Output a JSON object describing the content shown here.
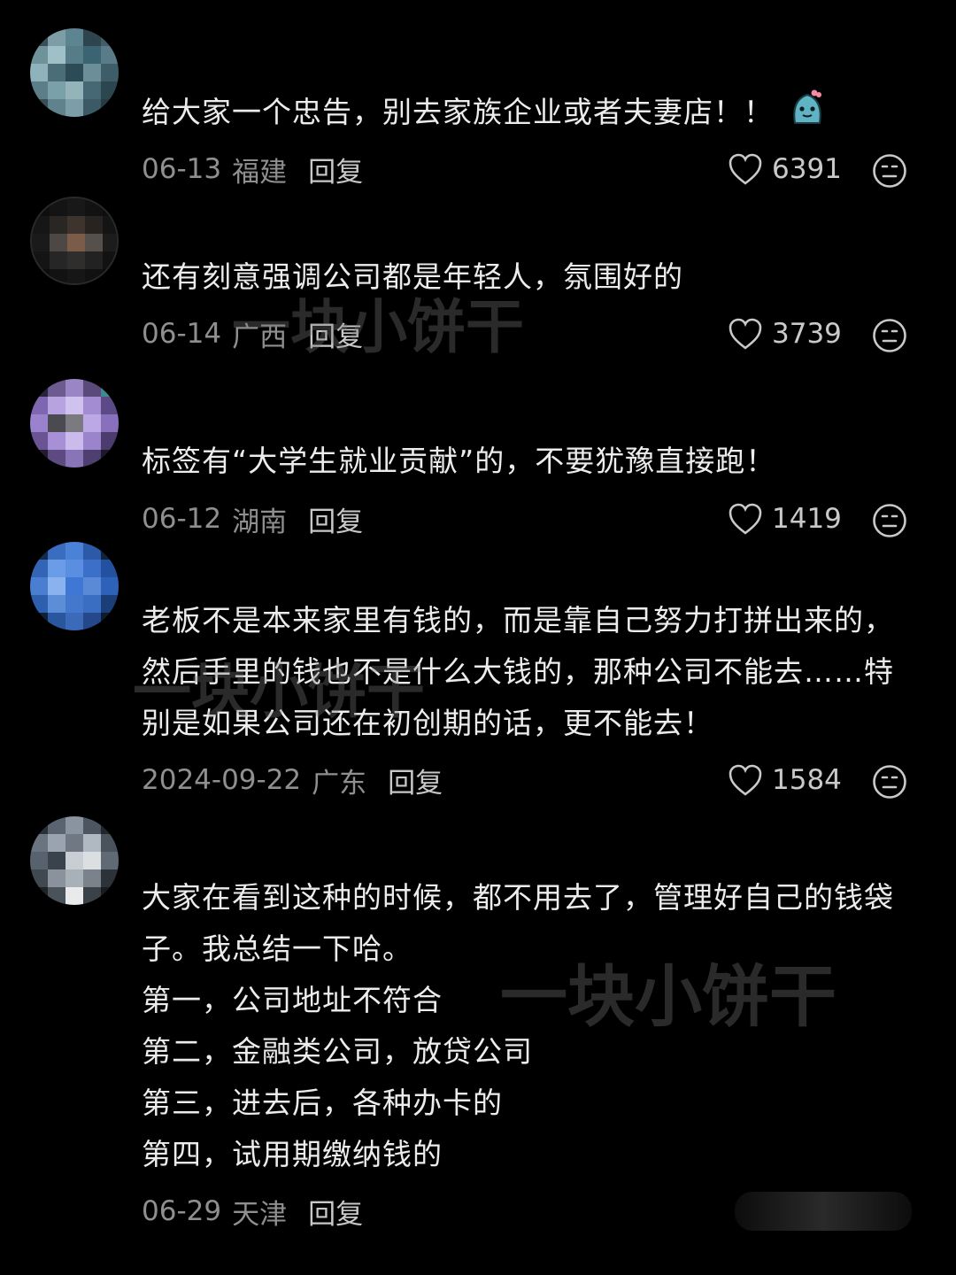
{
  "comments": [
    {
      "text": "给大家一个忠告，别去家族企业或者夫妻店！！",
      "emoji_icon": "cute-blob-emoji-icon",
      "date": "06-13",
      "location": "福建",
      "reply_label": "回复",
      "likes": "6391"
    },
    {
      "text": "还有刻意强调公司都是年轻人，氛围好的",
      "date": "06-14",
      "location": "广西",
      "reply_label": "回复",
      "likes": "3739"
    },
    {
      "text": "标签有“大学生就业贡献”的，不要犹豫直接跑！",
      "date": "06-12",
      "location": "湖南",
      "reply_label": "回复",
      "likes": "1419"
    },
    {
      "text": "老板不是本来家里有钱的，而是靠自己努力打拼出来的，然后手里的钱也不是什么大钱的，那种公司不能去……特别是如果公司还在初创期的话，更不能去！",
      "date": "2024-09-22",
      "location": "广东",
      "reply_label": "回复",
      "likes": "1584"
    },
    {
      "text": "大家在看到这种的时候，都不用去了，管理好自己的钱袋子。我总结一下哈。\n第一，公司地址不符合\n第二，金融类公司，放贷公司\n第三，进去后，各种办卡的\n第四，试用期缴纳钱的",
      "date": "06-29",
      "location": "天津",
      "reply_label": "回复"
    }
  ],
  "watermark": "一块小饼干",
  "colors": {
    "background": "#000000",
    "text": "#ececec",
    "meta": "#8f8f8f",
    "icon": "#c9c9c9"
  }
}
